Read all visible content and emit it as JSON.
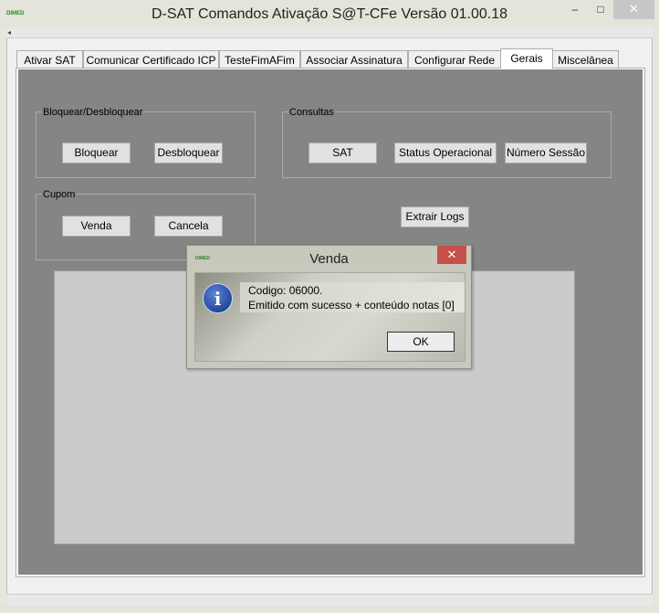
{
  "window": {
    "title": "D-SAT Comandos Ativação S@T-CFe Versão 01.00.18",
    "logo_text": "DIMED",
    "minimize_glyph": "–",
    "maximize_glyph": "□",
    "close_glyph": "✕"
  },
  "scrollbar": {
    "arrow_glyph": "◂"
  },
  "tabs": [
    {
      "label": "Ativar SAT",
      "active": false
    },
    {
      "label": "Comunicar Certificado ICP",
      "active": false
    },
    {
      "label": "TesteFimAFim",
      "active": false
    },
    {
      "label": "Associar Assinatura",
      "active": false
    },
    {
      "label": "Configurar Rede",
      "active": false
    },
    {
      "label": "Gerais",
      "active": true
    },
    {
      "label": "Miscelânea",
      "active": false
    }
  ],
  "groups": {
    "bloquear": {
      "label": "Bloquear/Desbloquear",
      "buttons": [
        "Bloquear",
        "Desbloquear"
      ]
    },
    "consultas": {
      "label": "Consultas",
      "buttons": [
        "SAT",
        "Status Operacional",
        "Número Sessão"
      ]
    },
    "cupom": {
      "label": "Cupom",
      "buttons": [
        "Venda",
        "Cancela"
      ]
    }
  },
  "extract_logs_label": "Extrair Logs",
  "dialog": {
    "title": "Venda",
    "logo_text": "DIMED",
    "close_glyph": "✕",
    "info_glyph": "i",
    "message_line1": "Codigo: 06000.",
    "message_line2": "Emitido com sucesso + conteúdo notas [0]",
    "ok_label": "OK"
  },
  "colors": {
    "panel_gray": "#858585",
    "dialog_close_red": "#c6504a",
    "info_icon_blue": "#24479f"
  }
}
